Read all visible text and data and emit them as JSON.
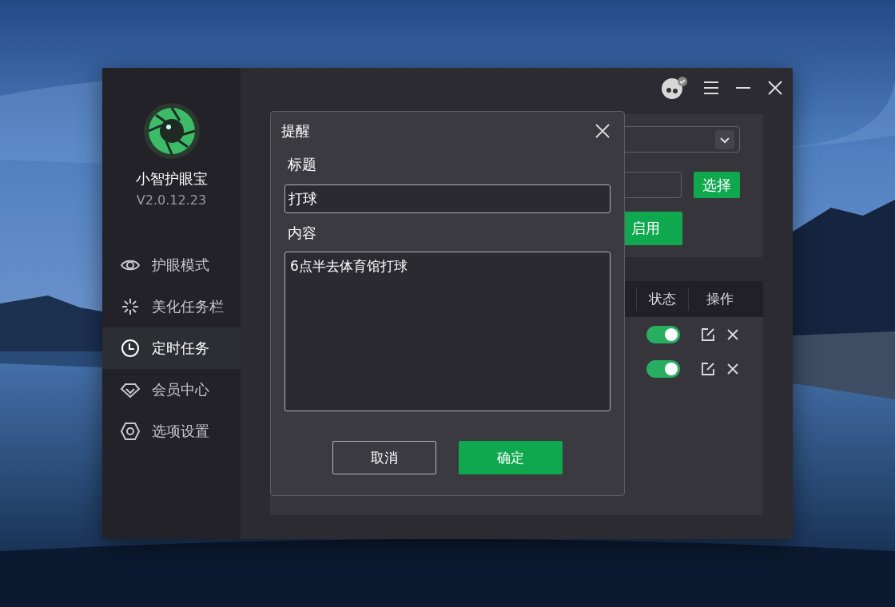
{
  "app": {
    "name": "小智护眼宝",
    "version": "V2.0.12.23"
  },
  "nav": [
    {
      "label": "护眼模式",
      "selected": false
    },
    {
      "label": "美化任务栏",
      "selected": false
    },
    {
      "label": "定时任务",
      "selected": true
    },
    {
      "label": "会员中心",
      "selected": false
    },
    {
      "label": "选项设置",
      "selected": false
    }
  ],
  "panel": {
    "choose_button": "选择",
    "enable_button": "启用"
  },
  "table": {
    "columns": [
      "状态",
      "操作"
    ],
    "rows": [
      {
        "on": true
      },
      {
        "on": true
      }
    ]
  },
  "dialog": {
    "title": "提醒",
    "fields": [
      {
        "label": "标题",
        "value": "打球",
        "kind": "input"
      },
      {
        "label": "内容",
        "value": "6点半去体育馆打球",
        "kind": "textarea"
      }
    ],
    "buttons": [
      {
        "label": "取消",
        "kind": "secondary"
      },
      {
        "label": "确定",
        "kind": "primary"
      }
    ]
  }
}
